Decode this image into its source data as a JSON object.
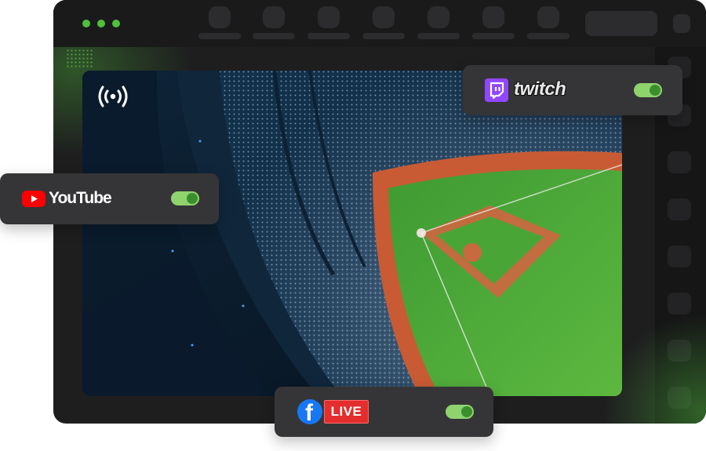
{
  "window": {
    "controls": [
      "window-dot",
      "window-dot",
      "window-dot"
    ],
    "accent_color": "#4fbf3b"
  },
  "preview": {
    "scene": "aerial view of a baseball stadium at night",
    "broadcast_icon": "broadcast-icon"
  },
  "destinations": {
    "twitch": {
      "name": "twitch",
      "enabled": true,
      "brand_color": "#9146ff",
      "icon": "twitch-logo-icon"
    },
    "youtube": {
      "name": "YouTube",
      "enabled": true,
      "brand_color": "#ff0000",
      "icon": "youtube-logo-icon"
    },
    "facebook": {
      "badge": "LIVE",
      "enabled": true,
      "brand_color": "#1877f2",
      "badge_color": "#e42d2d",
      "icon": "facebook-logo-icon"
    }
  },
  "toggle_color": "#8fd36f"
}
